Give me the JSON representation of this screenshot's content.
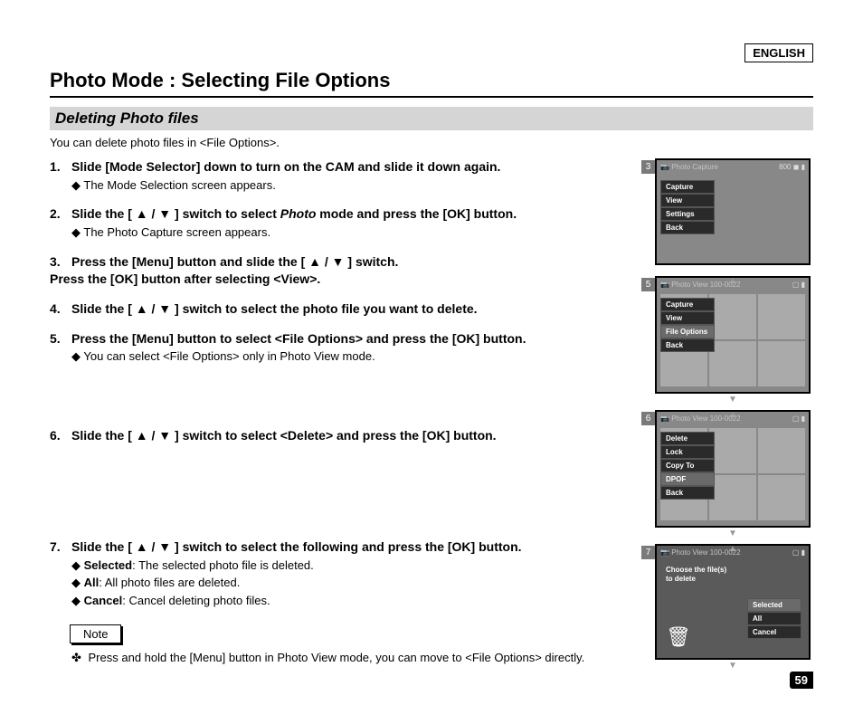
{
  "lang": "ENGLISH",
  "title": "Photo Mode : Selecting File Options",
  "section": "Deleting Photo files",
  "intro": "You can delete photo files in <File Options>.",
  "steps": {
    "s1": {
      "n": "1.",
      "text": "Slide [Mode Selector] down to turn on the CAM and slide it down again.",
      "sub1": "The Mode Selection screen appears."
    },
    "s2": {
      "n": "2.",
      "pre": "Slide the [ ▲ / ▼ ] switch to select ",
      "ital": "Photo",
      "post": " mode and press the [OK] button.",
      "sub1": "The Photo Capture screen appears."
    },
    "s3": {
      "n": "3.",
      "line1": "Press the [Menu] button and slide the [ ▲ / ▼ ] switch.",
      "line2": "Press the [OK] button after selecting <View>."
    },
    "s4": {
      "n": "4.",
      "text": "Slide the [ ▲ / ▼ ] switch to select the photo file you want to delete."
    },
    "s5": {
      "n": "5.",
      "text": "Press the [Menu] button to select <File Options> and press the [OK] button.",
      "sub1": "You can select <File Options> only in Photo View mode."
    },
    "s6": {
      "n": "6.",
      "text": "Slide the [ ▲ / ▼ ] switch to select <Delete> and press the [OK] button."
    },
    "s7": {
      "n": "7.",
      "text": "Slide the [ ▲ / ▼ ] switch to select the following and press the [OK] button.",
      "sub1b": "Selected",
      "sub1": ": The selected photo file is deleted.",
      "sub2b": "All",
      "sub2": ": All photo files are deleted.",
      "sub3b": "Cancel",
      "sub3": ": Cancel deleting photo files."
    }
  },
  "note_label": "Note",
  "note_text": "Press and hold the [Menu] button in Photo View mode, you can move to <File Options> directly.",
  "screens": {
    "s3": {
      "tag": "3",
      "title": "Photo Capture",
      "badge": "800",
      "menu": [
        "Capture",
        "View",
        "Settings",
        "Back"
      ]
    },
    "s5": {
      "tag": "5",
      "title": "Photo View 100-0022",
      "menu": [
        "Capture",
        "View",
        "File Options",
        "Back"
      ],
      "sel": 2
    },
    "s6": {
      "tag": "6",
      "title": "Photo View 100-0022",
      "menu": [
        "Delete",
        "Lock",
        "Copy To",
        "DPOF",
        "Back"
      ],
      "sel": 3
    },
    "s7": {
      "tag": "7",
      "title": "Photo View 100-0022",
      "prompt1": "Choose the file(s)",
      "prompt2": "to delete",
      "opts": [
        "Selected",
        "All",
        "Cancel"
      ],
      "sel": 0
    }
  },
  "page_num": "59"
}
